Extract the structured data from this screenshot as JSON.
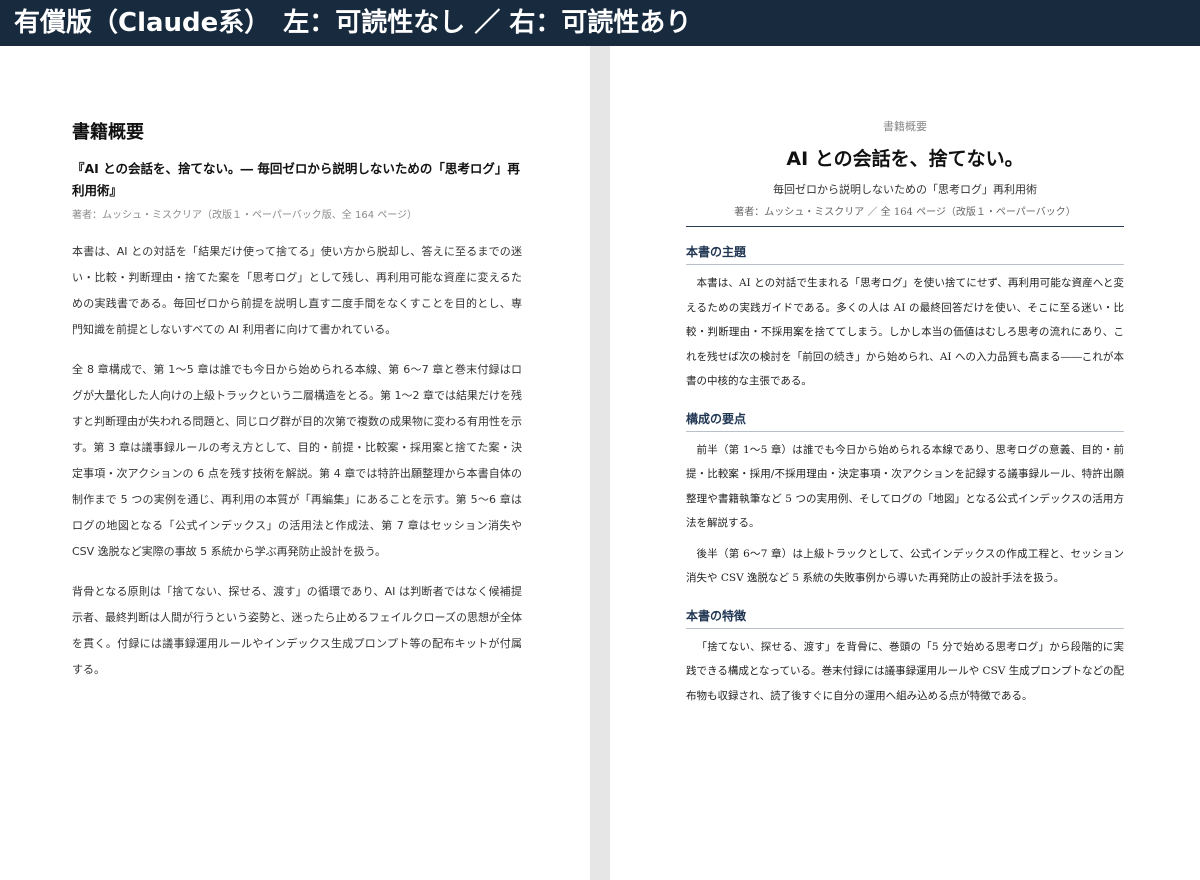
{
  "banner": "有償版（Claude系）　左：可読性なし ／ 右：可読性あり",
  "left": {
    "heading": "書籍概要",
    "title": "『AI との会話を、捨てない。― 毎回ゼロから説明しないための「思考ログ」再利用術』",
    "author": "著者：ムッシュ・ミスクリア（改版１・ペーパーバック版、全 164 ページ）",
    "paragraphs": [
      "本書は、AI との対話を「結果だけ使って捨てる」使い方から脱却し、答えに至るまでの迷い・比較・判断理由・捨てた案を「思考ログ」として残し、再利用可能な資産に変えるための実践書である。毎回ゼロから前提を説明し直す二度手間をなくすことを目的とし、専門知識を前提としないすべての AI 利用者に向けて書かれている。",
      "全 8 章構成で、第 1〜5 章は誰でも今日から始められる本線、第 6〜7 章と巻末付録はログが大量化した人向けの上級トラックという二層構造をとる。第 1〜2 章では結果だけを残すと判断理由が失われる問題と、同じログ群が目的次第で複数の成果物に変わる有用性を示す。第 3 章は議事録ルールの考え方として、目的・前提・比較案・採用案と捨てた案・決定事項・次アクションの 6 点を残す技術を解説。第 4 章では特許出願整理から本書自体の制作まで 5 つの実例を通じ、再利用の本質が「再編集」にあることを示す。第 5〜6 章はログの地図となる「公式インデックス」の活用法と作成法、第 7 章はセッション消失や CSV 逸脱など実際の事故 5 系統から学ぶ再発防止設計を扱う。",
      "背骨となる原則は「捨てない、探せる、渡す」の循環であり、AI は判断者ではなく候補提示者、最終判断は人間が行うという姿勢と、迷ったら止めるフェイルクローズの思想が全体を貫く。付録には議事録運用ルールやインデックス生成プロンプト等の配布キットが付属する。"
    ]
  },
  "right": {
    "label": "書籍概要",
    "title": "AI との会話を、捨てない。",
    "subtitle": "毎回ゼロから説明しないための「思考ログ」再利用術",
    "author": "著者：ムッシュ・ミスクリア ／ 全 164 ページ（改版１・ペーパーバック）",
    "sections": [
      {
        "title": "本書の主題",
        "paragraphs": [
          "本書は、AI との対話で生まれる「思考ログ」を使い捨てにせず、再利用可能な資産へと変えるための実践ガイドである。多くの人は AI の最終回答だけを使い、そこに至る迷い・比較・判断理由・不採用案を捨ててしまう。しかし本当の価値はむしろ思考の流れにあり、これを残せば次の検討を「前回の続き」から始められ、AI への入力品質も高まる――これが本書の中核的な主張である。"
        ]
      },
      {
        "title": "構成の要点",
        "paragraphs": [
          "前半（第 1〜5 章）は誰でも今日から始められる本線であり、思考ログの意義、目的・前提・比較案・採用/不採用理由・決定事項・次アクションを記録する議事録ルール、特許出願整理や書籍執筆など 5 つの実用例、そしてログの「地図」となる公式インデックスの活用方法を解説する。",
          "後半（第 6〜7 章）は上級トラックとして、公式インデックスの作成工程と、セッション消失や CSV 逸脱など 5 系統の失敗事例から導いた再発防止の設計手法を扱う。"
        ]
      },
      {
        "title": "本書の特徴",
        "paragraphs": [
          "「捨てない、探せる、渡す」を背骨に、巻頭の「5 分で始める思考ログ」から段階的に実践できる構成となっている。巻末付録には議事録運用ルールや CSV 生成プロンプトなどの配布物も収録され、読了後すぐに自分の運用へ組み込める点が特徴である。"
        ]
      }
    ]
  }
}
